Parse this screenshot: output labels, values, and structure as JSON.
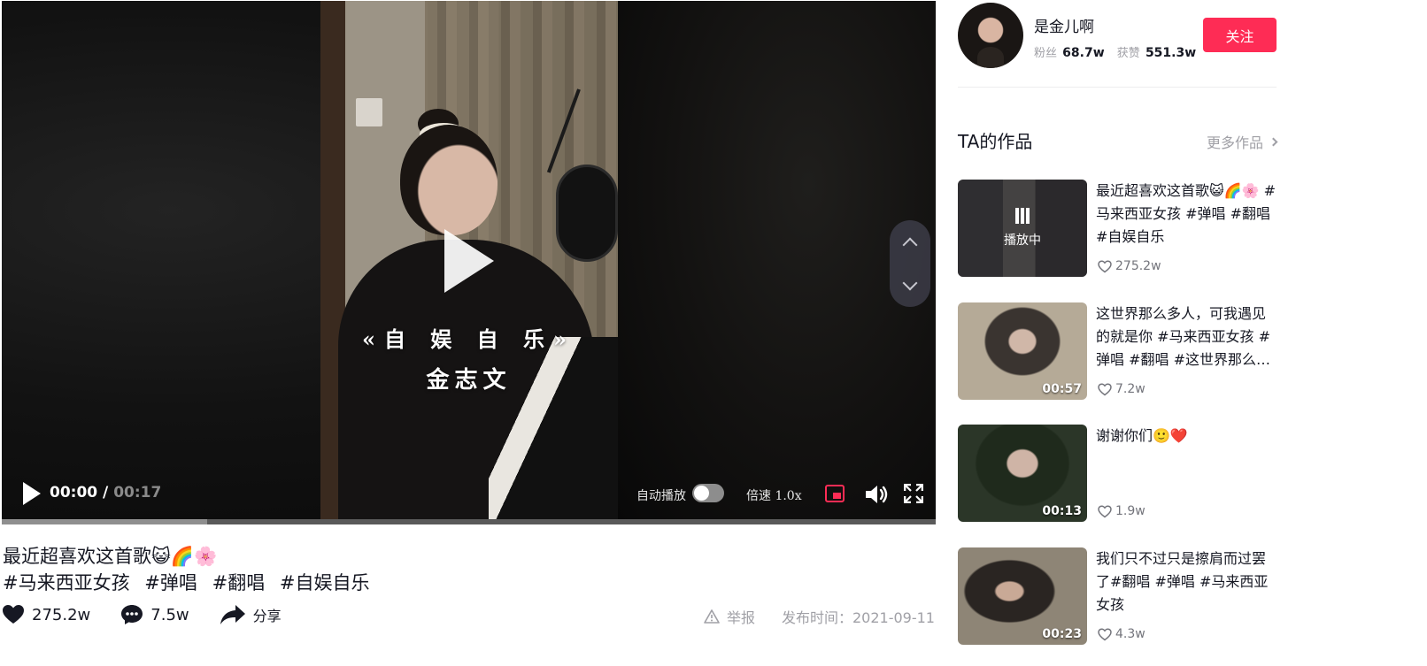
{
  "video": {
    "caption_line1": "«自 娱 自 乐»",
    "caption_line2": "金志文",
    "current_time": "00:00",
    "separator": "/",
    "duration": "00:17",
    "autoplay_label": "自动播放",
    "autoplay_on": false,
    "speed_label": "倍速",
    "speed_value": "1.0x",
    "progress": 0.22
  },
  "post": {
    "title": "最近超喜欢这首歌😺🌈🌸",
    "tags": [
      "#马来西亚女孩",
      "#弹唱",
      "#翻唱",
      "#自娱自乐"
    ],
    "likes": "275.2w",
    "comments": "7.5w",
    "share_label": "分享",
    "report_label": "举报",
    "publish_time": "发布时间：2021-09-11"
  },
  "author": {
    "name": "是金儿啊",
    "fans_label": "粉丝",
    "fans": "68.7w",
    "likes_label": "获赞",
    "likes": "551.3w",
    "follow_label": "关注"
  },
  "works": {
    "title": "TA的作品",
    "more_label": "更多作品",
    "playing_label": "播放中",
    "items": [
      {
        "desc": "最近超喜欢这首歌😺🌈🌸 #马来西亚女孩 #弹唱 #翻唱 #自娱自乐",
        "likes": "275.2w",
        "duration": ""
      },
      {
        "desc": "这世界那么多人，可我遇见的就是你 #马来西亚女孩 #弹唱 #翻唱 #这世界那么多人",
        "likes": "7.2w",
        "duration": "00:57"
      },
      {
        "desc": "谢谢你们🙂❤️",
        "likes": "1.9w",
        "duration": "00:13"
      },
      {
        "desc": "我们只不过只是擦肩而过罢了#翻唱 #弹唱 #马来西亚女孩",
        "likes": "4.3w",
        "duration": "00:23"
      }
    ]
  },
  "colors": {
    "accent": "#fe2c55",
    "text": "#161823",
    "muted": "#a0a0a6"
  }
}
